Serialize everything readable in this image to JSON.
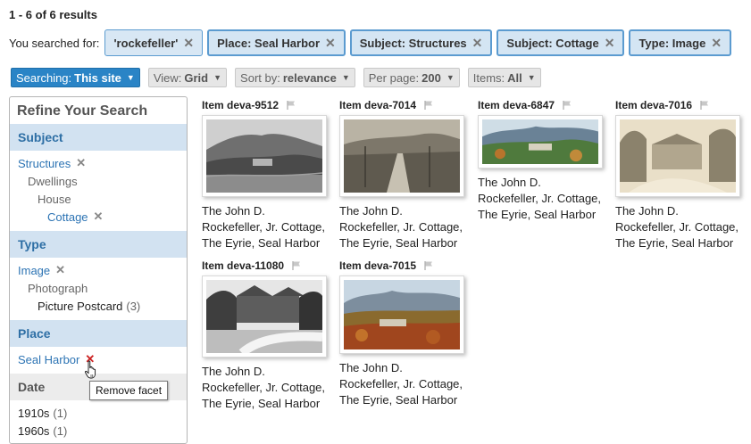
{
  "results_count": "1 - 6 of 6 results",
  "searched": {
    "label": "You searched for:",
    "chips": [
      "'rockefeller'",
      "Place: Seal Harbor",
      "Subject: Structures",
      "Subject: Cottage",
      "Type: Image"
    ],
    "remove_glyph": "✕"
  },
  "controls": {
    "searching": {
      "label": "Searching:",
      "value": "This site"
    },
    "view": {
      "label": "View:",
      "value": "Grid"
    },
    "sort": {
      "label": "Sort by:",
      "value": "relevance"
    },
    "per_page": {
      "label": "Per page:",
      "value": "200"
    },
    "items": {
      "label": "Items:",
      "value": "All"
    }
  },
  "refine": {
    "title": "Refine Your Search",
    "subject": {
      "heading": "Subject",
      "items": [
        "Structures",
        "Dwellings",
        "House",
        "Cottage"
      ]
    },
    "type": {
      "heading": "Type",
      "items": [
        "Image",
        "Photograph",
        "Picture Postcard"
      ],
      "picture_postcard_count": "(3)"
    },
    "place": {
      "heading": "Place",
      "items": [
        "Seal Harbor"
      ]
    },
    "date": {
      "heading": "Date",
      "items": [
        {
          "label": "1910s",
          "count": "(1)"
        },
        {
          "label": "1960s",
          "count": "(1)"
        }
      ]
    }
  },
  "tooltip": "Remove facet",
  "items": [
    {
      "id": "Item deva-9512",
      "caption": [
        "The John D.",
        "Rockefeller, Jr. Cottage,",
        "The Eyrie, Seal Harbor"
      ]
    },
    {
      "id": "Item deva-7014",
      "caption": [
        "The John D.",
        "Rockefeller, Jr. Cottage,",
        "The Eyrie, Seal Harbor"
      ]
    },
    {
      "id": "Item deva-6847",
      "caption": [
        "The John D.",
        "Rockefeller, Jr. Cottage,",
        "The Eyrie, Seal Harbor"
      ]
    },
    {
      "id": "Item deva-7016",
      "caption": [
        "The John D.",
        "Rockefeller, Jr. Cottage,",
        "The Eyrie, Seal Harbor"
      ]
    },
    {
      "id": "Item deva-11080",
      "caption": [
        "The John D.",
        "Rockefeller, Jr. Cottage,",
        "The Eyrie, Seal Harbor"
      ]
    },
    {
      "id": "Item deva-7015",
      "caption": [
        "The John D.",
        "Rockefeller, Jr. Cottage,",
        "The Eyrie, Seal Harbor"
      ]
    }
  ],
  "icons": {
    "remove": "close-icon",
    "flag": "flag-icon",
    "caret": "caret-down-icon",
    "cursor": "hand-pointer-icon"
  },
  "colors": {
    "link": "#2d74b4",
    "facet_bg": "#d2e2f1",
    "chip_border": "#5b9bd0",
    "primary_button": "#2a84c6",
    "remove_red": "#cc2222"
  }
}
